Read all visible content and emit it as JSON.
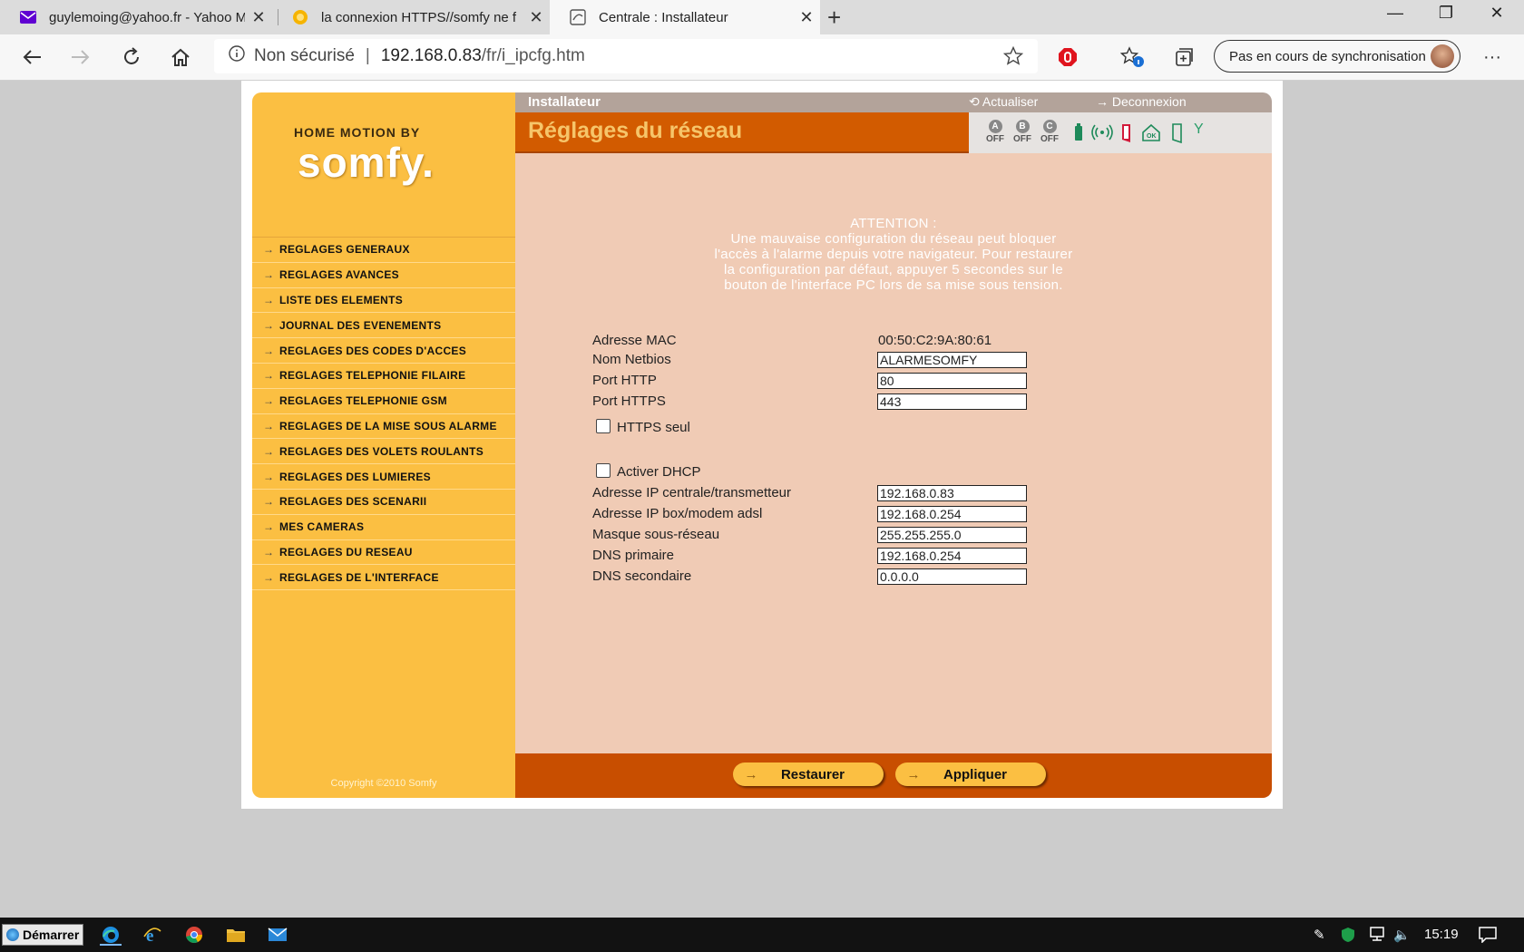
{
  "browser": {
    "tabs": [
      {
        "title": "guylemoing@yahoo.fr - Yahoo M"
      },
      {
        "title": "la connexion HTTPS//somfy ne f"
      },
      {
        "title": "Centrale : Installateur"
      }
    ],
    "security": "Non sécurisé",
    "separator": "|",
    "url_host": "192.168.0.83",
    "url_path": "/fr/i_ipcfg.htm",
    "sync_label": "Pas en cours de synchronisation"
  },
  "brand": {
    "line1": "HOME MOTION BY",
    "line2": "somfy."
  },
  "menu": [
    "REGLAGES GENERAUX",
    "REGLAGES AVANCES",
    "LISTE DES ELEMENTS",
    "JOURNAL DES EVENEMENTS",
    "REGLAGES DES CODES D'ACCES",
    "REGLAGES TELEPHONIE FILAIRE",
    "REGLAGES TELEPHONIE GSM",
    "REGLAGES DE LA MISE SOUS ALARME",
    "REGLAGES DES VOLETS ROULANTS",
    "REGLAGES DES LUMIERES",
    "REGLAGES DES SCENARII",
    "MES CAMERAS",
    "REGLAGES DU RESEAU",
    "REGLAGES DE L'INTERFACE"
  ],
  "copyright": "Copyright ©2010 Somfy",
  "topbar": {
    "role": "Installateur",
    "refresh": "Actualiser",
    "logout": "Deconnexion"
  },
  "title": "Réglages du réseau",
  "zones": [
    {
      "letter": "A",
      "state": "OFF"
    },
    {
      "letter": "B",
      "state": "OFF"
    },
    {
      "letter": "C",
      "state": "OFF"
    }
  ],
  "warning": {
    "heading": "ATTENTION :",
    "body": "Une mauvaise configuration du réseau peut bloquer l'accès à l'alarme depuis votre navigateur. Pour restaurer la configuration par défaut, appuyer 5 secondes sur le bouton de l'interface PC lors de sa mise sous tension."
  },
  "form": {
    "mac_label": "Adresse MAC",
    "mac_value": "00:50:C2:9A:80:61",
    "netbios_label": "Nom Netbios",
    "netbios_value": "ALARMESOMFY",
    "http_label": "Port HTTP",
    "http_value": "80",
    "https_label": "Port HTTPS",
    "https_value": "443",
    "https_only_label": "HTTPS seul",
    "dhcp_label": "Activer DHCP",
    "ip_label": "Adresse IP centrale/transmetteur",
    "ip_value": "192.168.0.83",
    "gw_label": "Adresse IP box/modem adsl",
    "gw_value": "192.168.0.254",
    "mask_label": "Masque sous-réseau",
    "mask_value": "255.255.255.0",
    "dns1_label": "DNS primaire",
    "dns1_value": "192.168.0.254",
    "dns2_label": "DNS secondaire",
    "dns2_value": "0.0.0.0"
  },
  "buttons": {
    "restore": "Restaurer",
    "apply": "Appliquer"
  },
  "taskbar": {
    "start": "Démarrer",
    "time": "15:19"
  }
}
